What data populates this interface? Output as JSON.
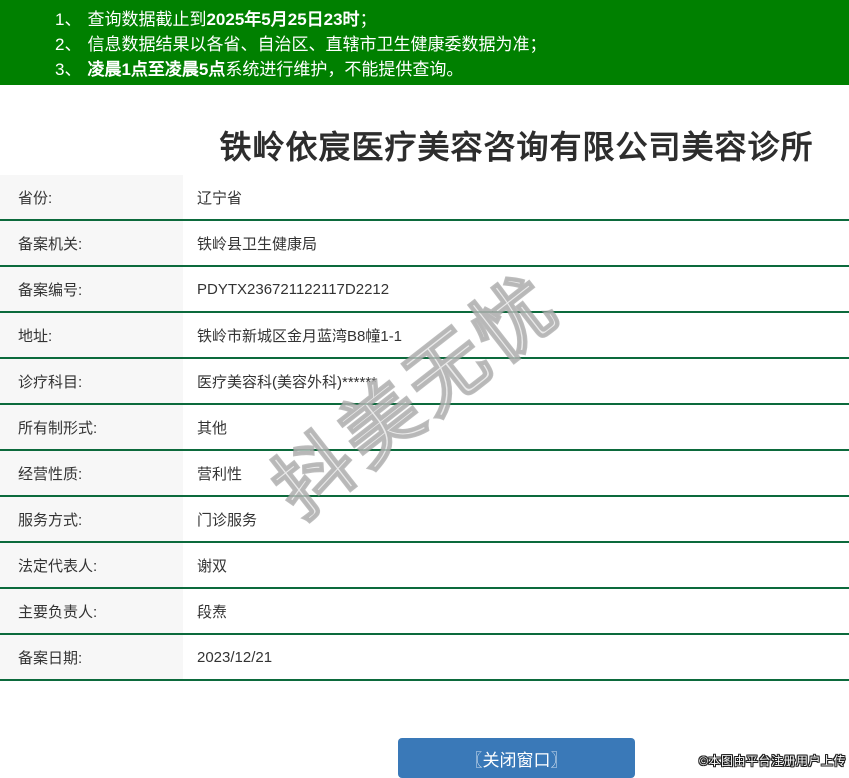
{
  "colors": {
    "banner_background": "#008000",
    "table_line": "#0c6a3c",
    "label_cell_background": "#f7f7f7",
    "button_blue": "#3a79b8"
  },
  "notice_banner": {
    "items": [
      {
        "number": "1、",
        "segments": [
          {
            "text": "查询数据截止到",
            "bold": false
          },
          {
            "text": "2025年5月25日23时",
            "bold": true
          },
          {
            "text": "；",
            "bold": false
          }
        ]
      },
      {
        "number": "2、",
        "segments": [
          {
            "text": "信息数据结果以各省、自治区、直辖市卫生健康委数据为准；",
            "bold": false
          }
        ]
      },
      {
        "number": "3、",
        "segments": [
          {
            "text": "凌晨1点至凌晨5点",
            "bold": true
          },
          {
            "text": "系统进行维护，不能提供查询。",
            "bold": false
          }
        ]
      }
    ]
  },
  "page": {
    "title": "铁岭依宸医疗美容咨询有限公司美容诊所"
  },
  "record_table": {
    "rows": [
      {
        "label": "省份:",
        "value": "辽宁省"
      },
      {
        "label": "备案机关:",
        "value": "铁岭县卫生健康局"
      },
      {
        "label": "备案编号:",
        "value": "PDYTX236721122117D2212"
      },
      {
        "label": "地址:",
        "value": "铁岭市新城区金月蓝湾B8幢1-1"
      },
      {
        "label": "诊疗科目:",
        "value": "医疗美容科(美容外科)******"
      },
      {
        "label": "所有制形式:",
        "value": "其他"
      },
      {
        "label": "经营性质:",
        "value": "营利性"
      },
      {
        "label": "服务方式:",
        "value": "门诊服务"
      },
      {
        "label": "法定代表人:",
        "value": "谢双"
      },
      {
        "label": "主要负责人:",
        "value": "段焘"
      },
      {
        "label": "备案日期:",
        "value": "2023/12/21"
      }
    ]
  },
  "watermark": {
    "text": "抖美无忧"
  },
  "footer": {
    "close_button_label": "〖关闭窗口〗",
    "copyright_text": "©本图由平台注册用户上传"
  }
}
